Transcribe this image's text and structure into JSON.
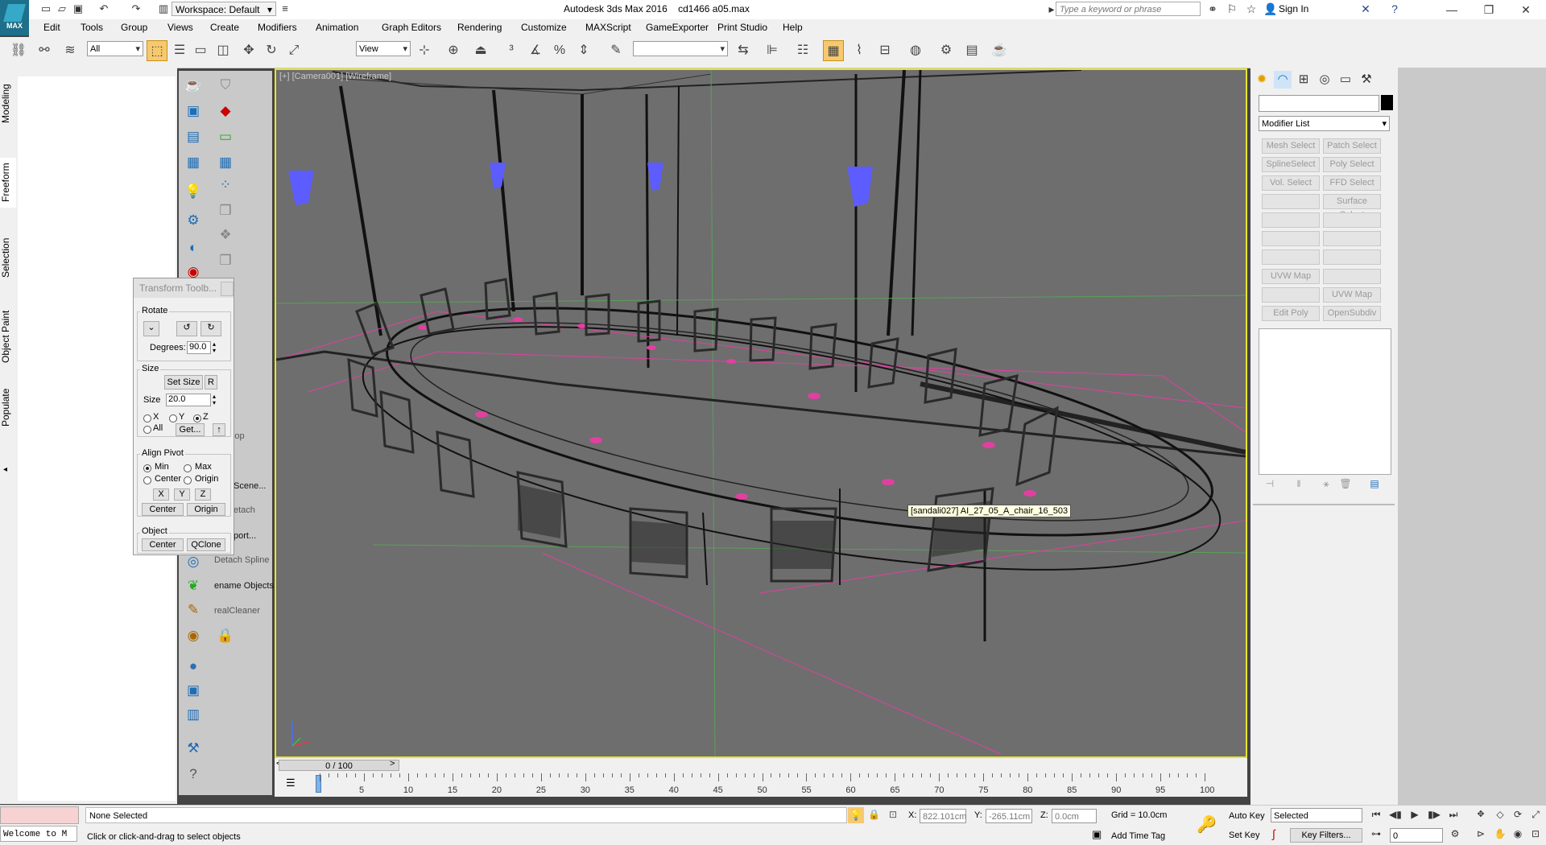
{
  "title_bar": {
    "app_title": "Autodesk 3ds Max 2016",
    "file_name": "cd1466 a05.max",
    "workspace": "Workspace: Default",
    "search_placeholder": "Type a keyword or phrase",
    "sign_in": "Sign In",
    "logo_text": "MAX"
  },
  "menu": [
    "Edit",
    "Tools",
    "Group",
    "Views",
    "Create",
    "Modifiers",
    "Animation",
    "Graph Editors",
    "Rendering",
    "Customize",
    "MAXScript",
    "GameExporter",
    "Print Studio",
    "Help"
  ],
  "toolbar": {
    "selection_filter": "All",
    "ref_coord": "View",
    "named_selection": ""
  },
  "ribbon_tabs": [
    "Modeling",
    "Freeform",
    "Selection",
    "Object Paint",
    "Populate"
  ],
  "command_labels": [
    "ft Loop",
    "Scene...",
    "etach",
    "port...",
    "Detach Spline",
    "ename Objects",
    "realCleaner"
  ],
  "transform_toolbox": {
    "title": "Transform Toolb...",
    "rotate_label": "Rotate",
    "degrees_label": "Degrees:",
    "degrees_value": "90.0",
    "size_group": "Size",
    "set_size": "Set Size",
    "r_btn": "R",
    "size_label": "Size",
    "size_value": "20.0",
    "x": "X",
    "y": "Y",
    "z": "Z",
    "all": "All",
    "get": "Get...",
    "align_pivot": "Align Pivot",
    "min": "Min",
    "max": "Max",
    "center": "Center",
    "origin": "Origin",
    "center_btn": "Center",
    "origin_btn": "Origin",
    "object_group": "Object",
    "object_center": "Center",
    "qclone": "QClone"
  },
  "viewport": {
    "label": "[+] [Camera001] [Wireframe]",
    "tooltip": "[sandali027] AI_27_05_A_chair_16_503"
  },
  "modify_panel": {
    "modifier_list": "Modifier List",
    "buttons": [
      [
        "Mesh Select",
        "Patch Select"
      ],
      [
        "SplineSelect",
        "Poly Select"
      ],
      [
        "Vol. Select",
        "FFD Select"
      ],
      [
        "",
        "Surface Select"
      ],
      [
        "",
        ""
      ],
      [
        "",
        ""
      ],
      [
        "",
        ""
      ],
      [
        "UVW Map",
        ""
      ],
      [
        "",
        "UVW Map"
      ],
      [
        "Edit Poly",
        "OpenSubdiv"
      ]
    ]
  },
  "timeline": {
    "slider": "0 / 100",
    "ticks": [
      "5",
      "10",
      "15",
      "20",
      "25",
      "30",
      "35",
      "40",
      "45",
      "50",
      "55",
      "60",
      "65",
      "70",
      "75",
      "80",
      "85",
      "90",
      "95",
      "100"
    ]
  },
  "status": {
    "welcome": "Welcome to M",
    "selection": "None Selected",
    "prompt": "Click or click-and-drag to select objects",
    "x_label": "X:",
    "x_value": "822.101cm",
    "y_label": "Y:",
    "y_value": "-265.11cm",
    "z_label": "Z:",
    "z_value": "0.0cm",
    "grid": "Grid = 10.0cm",
    "add_time_tag": "Add Time Tag",
    "auto_key": "Auto Key",
    "set_key": "Set Key",
    "selected_dropdown": "Selected",
    "key_filters": "Key Filters...",
    "frame": "0"
  },
  "colors": {
    "viewport_bg": "#6e6e6e",
    "active_border": "#e5e52d",
    "lamp": "#5c5cff",
    "helper": "#e040a0"
  }
}
